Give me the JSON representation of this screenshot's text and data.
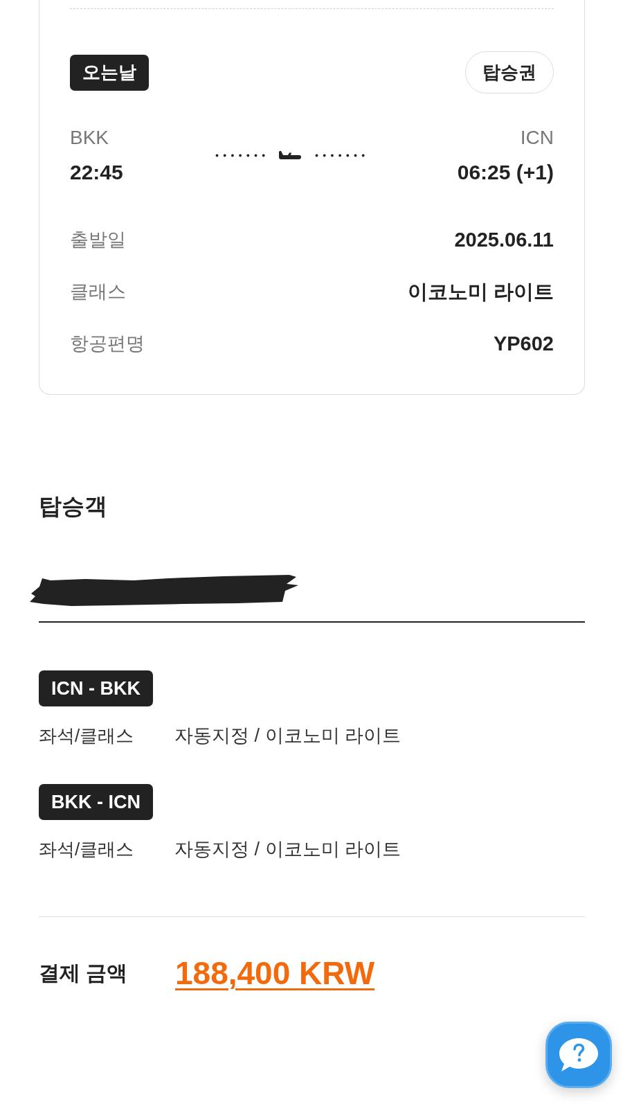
{
  "flight_card": {
    "badge": "오는날",
    "boarding_pass_button": "탑승권",
    "departure": {
      "airport": "BKK",
      "time": "22:45"
    },
    "arrival": {
      "airport": "ICN",
      "time": "06:25 (+1)"
    },
    "details": [
      {
        "label": "출발일",
        "value": "2025.06.11"
      },
      {
        "label": "클래스",
        "value": "이코노미 라이트"
      },
      {
        "label": "항공편명",
        "value": "YP602"
      }
    ]
  },
  "passengers": {
    "title": "탑승객",
    "segments": [
      {
        "route": "ICN - BKK",
        "label": "좌석/클래스",
        "value": "자동지정 / 이코노미 라이트"
      },
      {
        "route": "BKK - ICN",
        "label": "좌석/클래스",
        "value": "자동지정 / 이코노미 라이트"
      }
    ]
  },
  "payment": {
    "label": "결제 금액",
    "amount": "188,400 KRW"
  }
}
